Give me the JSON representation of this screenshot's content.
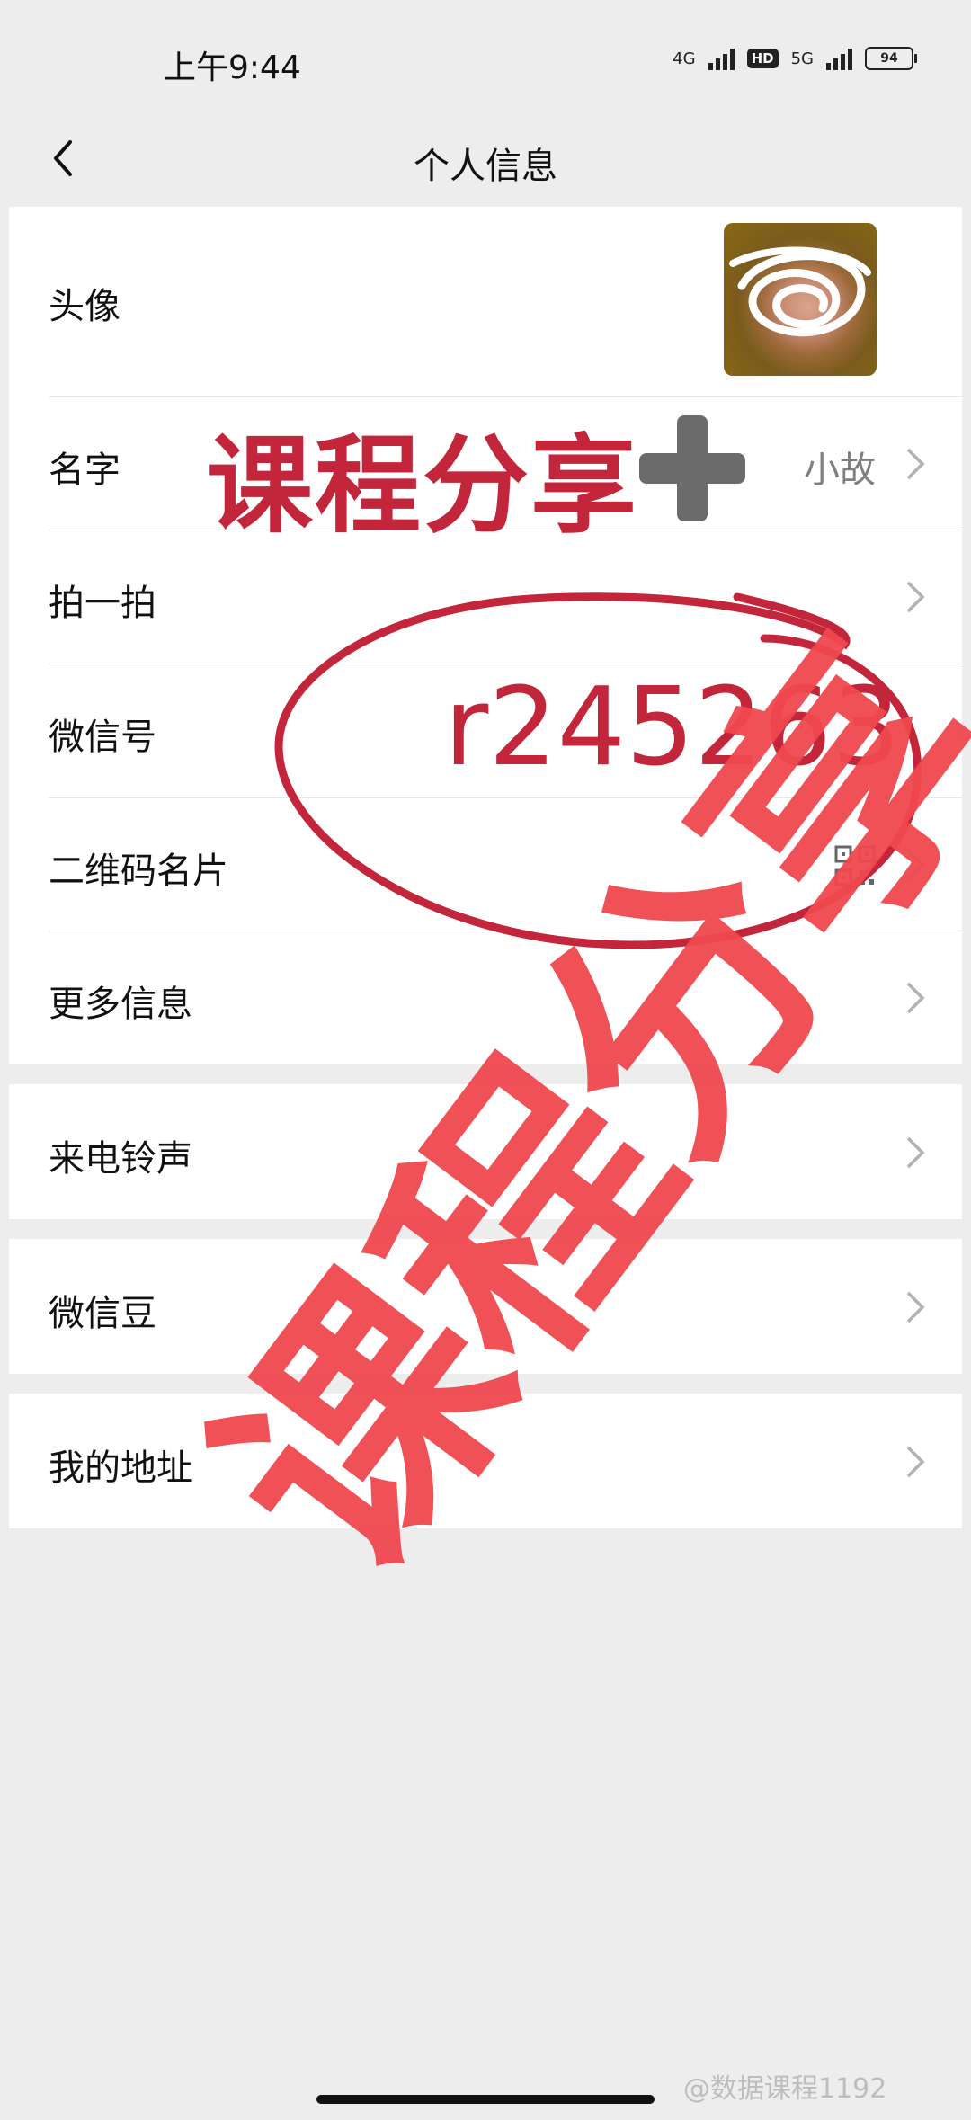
{
  "status_bar": {
    "time": "上午9:44",
    "net1": "4G",
    "hd": "HD",
    "net2": "5G",
    "battery": "94"
  },
  "header": {
    "title": "个人信息"
  },
  "profile_rows": [
    {
      "label": "头像"
    },
    {
      "label": "名字",
      "value": "小故"
    },
    {
      "label": "拍一拍"
    },
    {
      "label": "微信号"
    },
    {
      "label": "二维码名片"
    },
    {
      "label": "更多信息"
    }
  ],
  "section2": {
    "label": "来电铃声"
  },
  "section3": {
    "label": "微信豆"
  },
  "section4": {
    "label": "我的地址"
  },
  "overlay": {
    "top_watermark": "课程分享",
    "wechat_id": "r245263",
    "big_watermark": "课程分享",
    "bottom_credit": "@数据课程1192"
  },
  "colors": {
    "page_bg": "#ededed",
    "card_bg": "#ffffff",
    "text": "#111111",
    "secondary_text": "#7f7f7f",
    "annotation_red": "#c3253a",
    "watermark_red": "#f0484f"
  },
  "icons": [
    "back-arrow-icon",
    "chevron-right-icon",
    "qr-code-icon",
    "signal-icon",
    "battery-icon"
  ]
}
